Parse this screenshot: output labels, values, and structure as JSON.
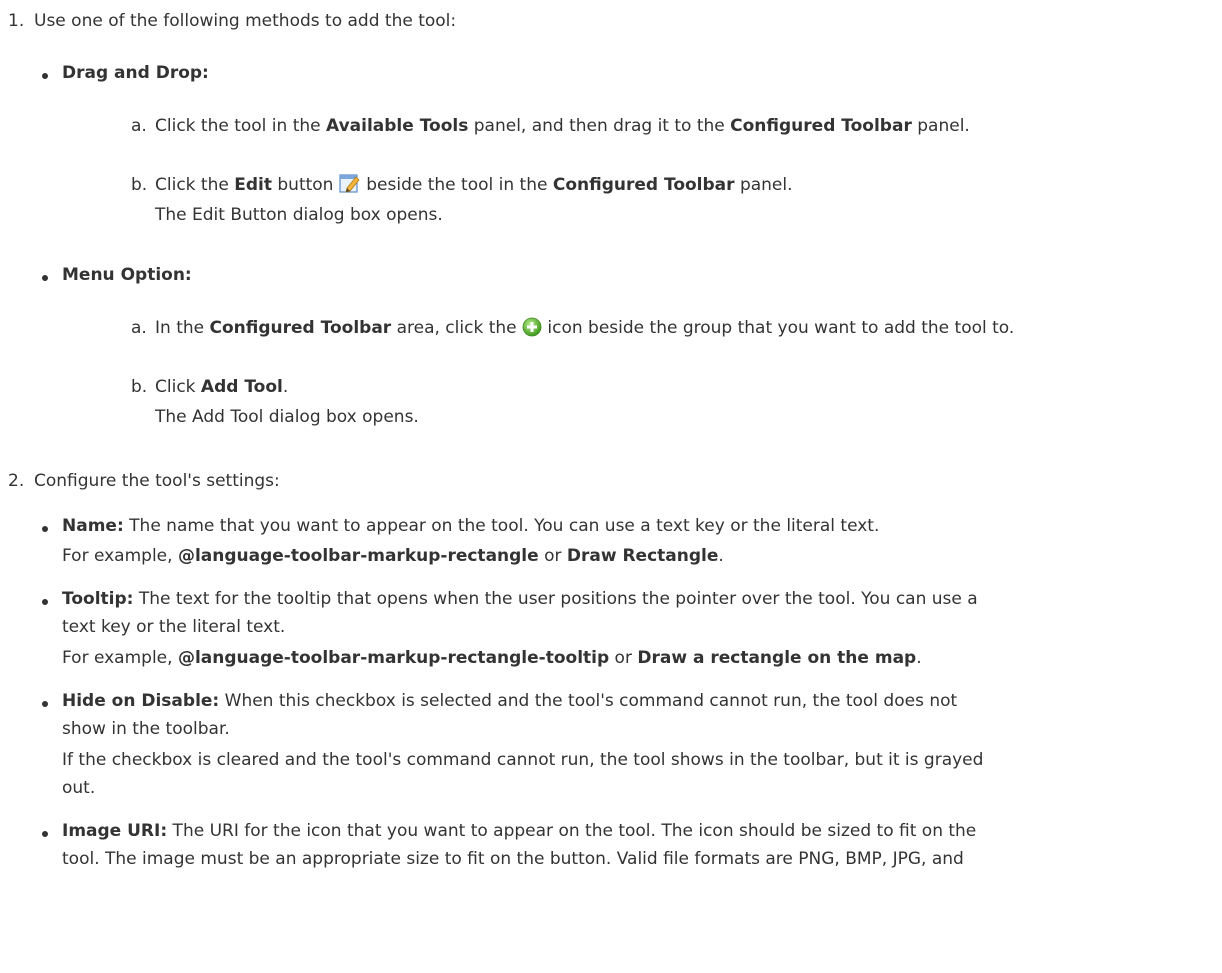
{
  "step1": {
    "num": "1.",
    "text": "Use one of the following methods to add the tool:",
    "drag_drop": {
      "title": "Drag and Drop:",
      "a": {
        "letter": "a.",
        "t1": "Click the tool in the ",
        "b1": "Available Tools",
        "t2": " panel, and then drag it to the ",
        "b2": "Configured Toolbar",
        "t3": " panel."
      },
      "b": {
        "letter": "b.",
        "t1": "Click the ",
        "b1": "Edit",
        "t2": " button ",
        "t3": " beside the tool in the ",
        "b2": "Configured Toolbar",
        "t4": " panel.",
        "note": "The Edit Button dialog box opens."
      }
    },
    "menu_option": {
      "title": "Menu Option:",
      "a": {
        "letter": "a.",
        "t1": "In the ",
        "b1": "Configured Toolbar",
        "t2": " area, click the ",
        "t3": " icon beside the group that you want to add the tool to."
      },
      "b": {
        "letter": "b.",
        "t1": "Click ",
        "b1": "Add Tool",
        "t2": ".",
        "note": "The Add Tool dialog box opens."
      }
    }
  },
  "step2": {
    "num": "2.",
    "text": "Configure the tool's settings:",
    "name": {
      "label": "Name:",
      "text": " The name that you want to appear on the tool. You can use a text key or the literal text.",
      "ex1": "For example, ",
      "exb1": "@language-toolbar-markup-rectangle",
      "ex2": " or ",
      "exb2": "Draw Rectangle",
      "ex3": "."
    },
    "tooltip": {
      "label": "Tooltip:",
      "line1": " The text for the tooltip that opens when the user positions the pointer over the tool. You can use a",
      "line2": "text key or the literal text.",
      "ex1": "For example, ",
      "exb1": "@language-toolbar-markup-rectangle-tooltip",
      "ex2": " or ",
      "exb2": "Draw a rectangle on the map",
      "ex3": "."
    },
    "hide": {
      "label": "Hide on Disable:",
      "line1": " When this checkbox is selected and the tool's command cannot run, the tool does not",
      "line2": "show in the toolbar.",
      "line3": "If the checkbox is cleared and the tool's command cannot run, the tool shows in the toolbar, but it is grayed",
      "line4": "out."
    },
    "image": {
      "label": "Image URI:",
      "line1": " The URI for the icon that you want to appear on the tool. The icon should be sized to fit on the",
      "line2": "tool. The image must be an appropriate size to fit on the button. Valid file formats are PNG, BMP, JPG, and"
    }
  }
}
